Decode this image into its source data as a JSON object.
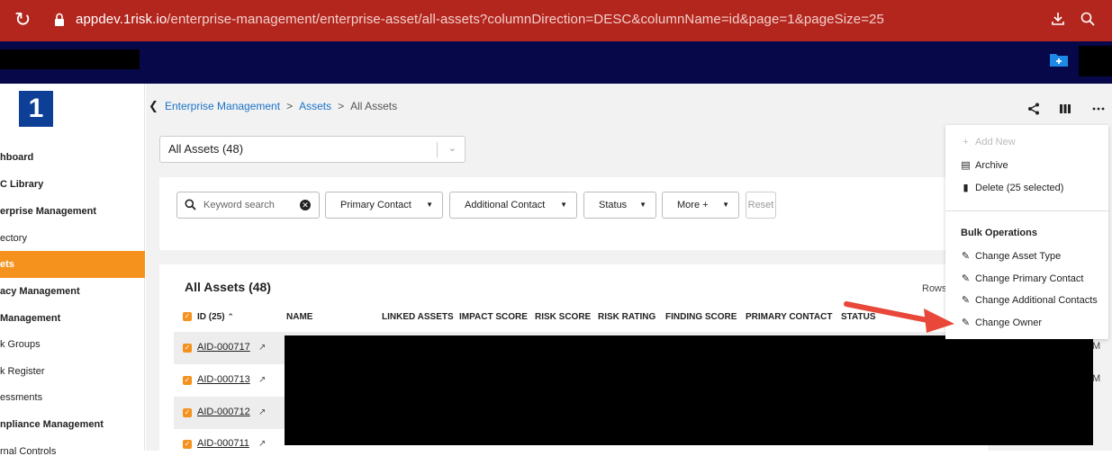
{
  "browser": {
    "url_host": "appdev.1risk.io",
    "url_path": "/enterprise-management/enterprise-asset/all-assets?columnDirection=DESC&columnName=id&page=1&pageSize=25"
  },
  "logo": {
    "text": "1"
  },
  "sidebar": {
    "items": [
      {
        "label": "hboard"
      },
      {
        "label": "C Library"
      },
      {
        "label": "erprise Management"
      },
      {
        "label": "ectory"
      },
      {
        "label": "ets"
      },
      {
        "label": "acy Management"
      },
      {
        "label": "Management"
      },
      {
        "label": "k Groups"
      },
      {
        "label": "k Register"
      },
      {
        "label": "essments"
      },
      {
        "label": "npliance Management"
      },
      {
        "label": "rnal Controls"
      }
    ]
  },
  "breadcrumb": {
    "items": [
      "Enterprise Management",
      "Assets",
      "All Assets"
    ],
    "separator": ">"
  },
  "view_select": {
    "value": "All Assets (48)"
  },
  "filters": {
    "search_placeholder": "Keyword search",
    "buttons": [
      "Primary Contact",
      "Additional Contact",
      "Status",
      "More +"
    ],
    "reset_label": "Reset"
  },
  "table": {
    "title": "All Assets (48)",
    "rows_label": "Rows",
    "headers": [
      "ID (25)",
      "NAME",
      "LINKED ASSETS",
      "IMPACT SCORE",
      "RISK SCORE",
      "RISK RATING",
      "FINDING SCORE",
      "PRIMARY CONTACT",
      "STATUS"
    ],
    "rows": [
      {
        "id": "AID-000717",
        "peek": "M"
      },
      {
        "id": "AID-000713",
        "peek": "M"
      },
      {
        "id": "AID-000712",
        "peek": ""
      },
      {
        "id": "AID-000711",
        "peek": ""
      }
    ]
  },
  "menu": {
    "add_new": "Add New",
    "archive": "Archive",
    "delete": "Delete (25 selected)",
    "bulk_heading": "Bulk Operations",
    "bulk_items": [
      "Change Asset Type",
      "Change Primary Contact",
      "Change Additional Contacts",
      "Change Owner"
    ]
  },
  "colors": {
    "browser_bar": "#b3261e",
    "header": "#06084a",
    "accent": "#f5921e",
    "link": "#1a73c8",
    "arrow": "#e8473a"
  },
  "icons": [
    "reload-icon",
    "lock-icon",
    "download-icon",
    "zoom-icon",
    "new-folder-icon",
    "share-icon",
    "columns-icon",
    "more-icon",
    "search-icon",
    "clear-icon",
    "sort-up-icon",
    "external-link-icon",
    "plus-icon",
    "archive-icon",
    "trash-icon",
    "edit-icon"
  ]
}
